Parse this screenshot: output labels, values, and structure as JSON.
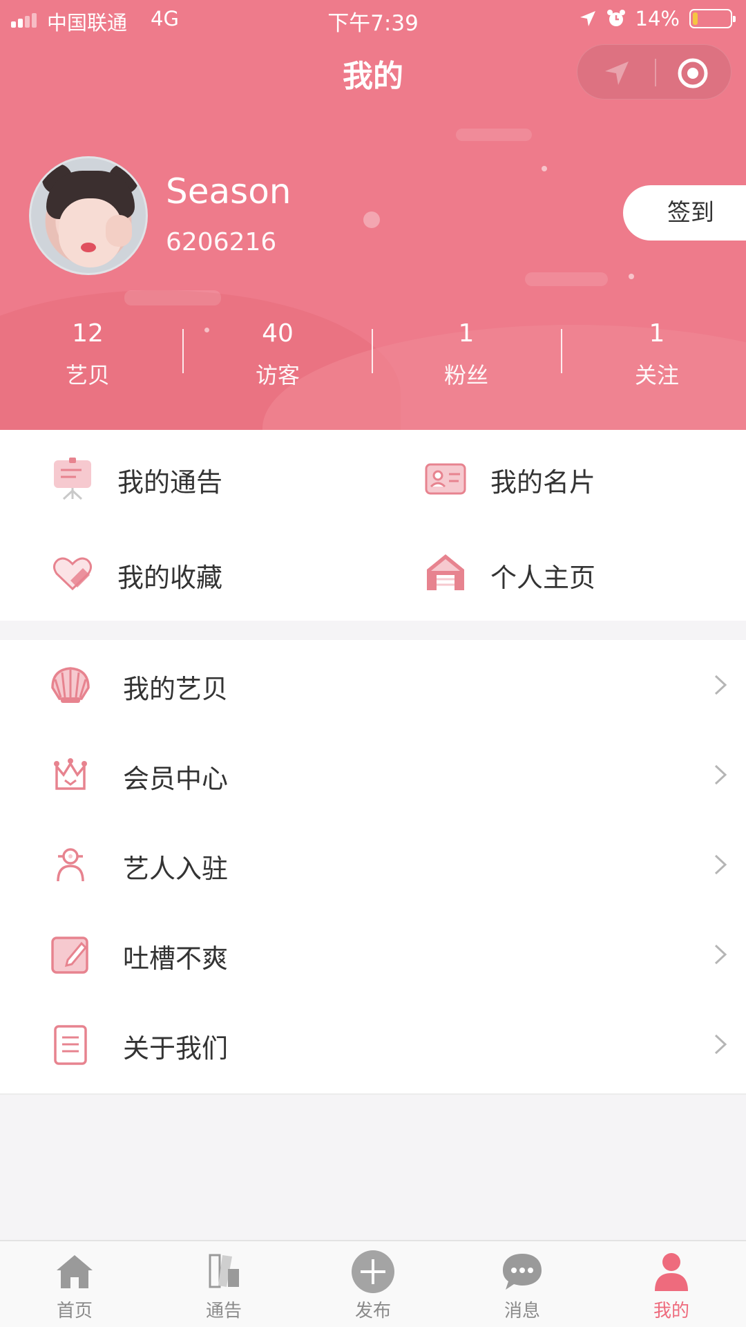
{
  "status_bar": {
    "carrier": "中国联通",
    "network": "4G",
    "time": "下午7:39",
    "battery": "14%",
    "battery_level": 0.14
  },
  "nav": {
    "title": "我的",
    "capsule_left_icon": "location-arrow-icon",
    "capsule_right_icon": "target-circle-icon"
  },
  "profile": {
    "name": "Season",
    "id": "6206216",
    "checkin_label": "签到"
  },
  "stats": [
    {
      "value": "12",
      "label": "艺贝"
    },
    {
      "value": "40",
      "label": "访客"
    },
    {
      "value": "1",
      "label": "粉丝"
    },
    {
      "value": "1",
      "label": "关注"
    }
  ],
  "grid_menu": [
    {
      "label": "我的通告",
      "icon": "easel-board-icon"
    },
    {
      "label": "我的名片",
      "icon": "id-card-icon"
    },
    {
      "label": "我的收藏",
      "icon": "heart-tag-icon"
    },
    {
      "label": "个人主页",
      "icon": "house-icon"
    }
  ],
  "list_menu": [
    {
      "label": "我的艺贝",
      "icon": "shell-icon"
    },
    {
      "label": "会员中心",
      "icon": "crown-icon"
    },
    {
      "label": "艺人入驻",
      "icon": "person-icon"
    },
    {
      "label": "吐槽不爽",
      "icon": "edit-note-icon"
    },
    {
      "label": "关于我们",
      "icon": "document-icon"
    }
  ],
  "tabbar": [
    {
      "label": "首页",
      "icon": "home-icon",
      "active": false
    },
    {
      "label": "通告",
      "icon": "books-icon",
      "active": false
    },
    {
      "label": "发布",
      "icon": "plus-circle-icon",
      "active": false
    },
    {
      "label": "消息",
      "icon": "chat-bubble-icon",
      "active": false
    },
    {
      "label": "我的",
      "icon": "user-icon",
      "active": true
    }
  ],
  "colors": {
    "accent": "#ee7b8b",
    "icon_pink": "#e7838f",
    "tab_active": "#ee6b7d",
    "tab_inactive": "#8a8a8a"
  }
}
